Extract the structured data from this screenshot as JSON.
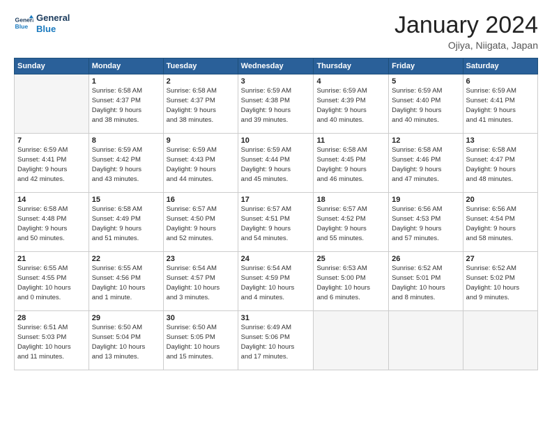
{
  "header": {
    "logo_line1": "General",
    "logo_line2": "Blue",
    "title": "January 2024",
    "subtitle": "Ojiya, Niigata, Japan"
  },
  "weekdays": [
    "Sunday",
    "Monday",
    "Tuesday",
    "Wednesday",
    "Thursday",
    "Friday",
    "Saturday"
  ],
  "weeks": [
    [
      {
        "day": "",
        "info": ""
      },
      {
        "day": "1",
        "info": "Sunrise: 6:58 AM\nSunset: 4:37 PM\nDaylight: 9 hours\nand 38 minutes."
      },
      {
        "day": "2",
        "info": "Sunrise: 6:58 AM\nSunset: 4:37 PM\nDaylight: 9 hours\nand 38 minutes."
      },
      {
        "day": "3",
        "info": "Sunrise: 6:59 AM\nSunset: 4:38 PM\nDaylight: 9 hours\nand 39 minutes."
      },
      {
        "day": "4",
        "info": "Sunrise: 6:59 AM\nSunset: 4:39 PM\nDaylight: 9 hours\nand 40 minutes."
      },
      {
        "day": "5",
        "info": "Sunrise: 6:59 AM\nSunset: 4:40 PM\nDaylight: 9 hours\nand 40 minutes."
      },
      {
        "day": "6",
        "info": "Sunrise: 6:59 AM\nSunset: 4:41 PM\nDaylight: 9 hours\nand 41 minutes."
      }
    ],
    [
      {
        "day": "7",
        "info": "Sunrise: 6:59 AM\nSunset: 4:41 PM\nDaylight: 9 hours\nand 42 minutes."
      },
      {
        "day": "8",
        "info": "Sunrise: 6:59 AM\nSunset: 4:42 PM\nDaylight: 9 hours\nand 43 minutes."
      },
      {
        "day": "9",
        "info": "Sunrise: 6:59 AM\nSunset: 4:43 PM\nDaylight: 9 hours\nand 44 minutes."
      },
      {
        "day": "10",
        "info": "Sunrise: 6:59 AM\nSunset: 4:44 PM\nDaylight: 9 hours\nand 45 minutes."
      },
      {
        "day": "11",
        "info": "Sunrise: 6:58 AM\nSunset: 4:45 PM\nDaylight: 9 hours\nand 46 minutes."
      },
      {
        "day": "12",
        "info": "Sunrise: 6:58 AM\nSunset: 4:46 PM\nDaylight: 9 hours\nand 47 minutes."
      },
      {
        "day": "13",
        "info": "Sunrise: 6:58 AM\nSunset: 4:47 PM\nDaylight: 9 hours\nand 48 minutes."
      }
    ],
    [
      {
        "day": "14",
        "info": "Sunrise: 6:58 AM\nSunset: 4:48 PM\nDaylight: 9 hours\nand 50 minutes."
      },
      {
        "day": "15",
        "info": "Sunrise: 6:58 AM\nSunset: 4:49 PM\nDaylight: 9 hours\nand 51 minutes."
      },
      {
        "day": "16",
        "info": "Sunrise: 6:57 AM\nSunset: 4:50 PM\nDaylight: 9 hours\nand 52 minutes."
      },
      {
        "day": "17",
        "info": "Sunrise: 6:57 AM\nSunset: 4:51 PM\nDaylight: 9 hours\nand 54 minutes."
      },
      {
        "day": "18",
        "info": "Sunrise: 6:57 AM\nSunset: 4:52 PM\nDaylight: 9 hours\nand 55 minutes."
      },
      {
        "day": "19",
        "info": "Sunrise: 6:56 AM\nSunset: 4:53 PM\nDaylight: 9 hours\nand 57 minutes."
      },
      {
        "day": "20",
        "info": "Sunrise: 6:56 AM\nSunset: 4:54 PM\nDaylight: 9 hours\nand 58 minutes."
      }
    ],
    [
      {
        "day": "21",
        "info": "Sunrise: 6:55 AM\nSunset: 4:55 PM\nDaylight: 10 hours\nand 0 minutes."
      },
      {
        "day": "22",
        "info": "Sunrise: 6:55 AM\nSunset: 4:56 PM\nDaylight: 10 hours\nand 1 minute."
      },
      {
        "day": "23",
        "info": "Sunrise: 6:54 AM\nSunset: 4:57 PM\nDaylight: 10 hours\nand 3 minutes."
      },
      {
        "day": "24",
        "info": "Sunrise: 6:54 AM\nSunset: 4:59 PM\nDaylight: 10 hours\nand 4 minutes."
      },
      {
        "day": "25",
        "info": "Sunrise: 6:53 AM\nSunset: 5:00 PM\nDaylight: 10 hours\nand 6 minutes."
      },
      {
        "day": "26",
        "info": "Sunrise: 6:52 AM\nSunset: 5:01 PM\nDaylight: 10 hours\nand 8 minutes."
      },
      {
        "day": "27",
        "info": "Sunrise: 6:52 AM\nSunset: 5:02 PM\nDaylight: 10 hours\nand 9 minutes."
      }
    ],
    [
      {
        "day": "28",
        "info": "Sunrise: 6:51 AM\nSunset: 5:03 PM\nDaylight: 10 hours\nand 11 minutes."
      },
      {
        "day": "29",
        "info": "Sunrise: 6:50 AM\nSunset: 5:04 PM\nDaylight: 10 hours\nand 13 minutes."
      },
      {
        "day": "30",
        "info": "Sunrise: 6:50 AM\nSunset: 5:05 PM\nDaylight: 10 hours\nand 15 minutes."
      },
      {
        "day": "31",
        "info": "Sunrise: 6:49 AM\nSunset: 5:06 PM\nDaylight: 10 hours\nand 17 minutes."
      },
      {
        "day": "",
        "info": ""
      },
      {
        "day": "",
        "info": ""
      },
      {
        "day": "",
        "info": ""
      }
    ]
  ]
}
